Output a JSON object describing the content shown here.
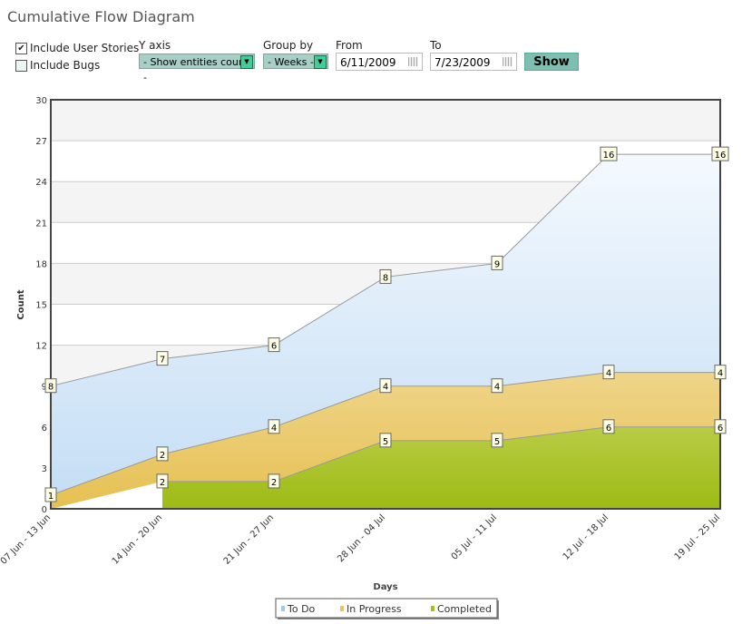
{
  "title": "Cumulative Flow Diagram",
  "controls": {
    "include_user_stories": {
      "label": "Include User Stories",
      "checked": true
    },
    "include_bugs": {
      "label": "Include Bugs",
      "checked": false
    },
    "y_axis": {
      "label": "Y axis",
      "value": "- Show entities count -"
    },
    "group_by": {
      "label": "Group by",
      "value": "- Weeks -"
    },
    "from": {
      "label": "From",
      "value": "6/11/2009"
    },
    "to": {
      "label": "To",
      "value": "7/23/2009"
    },
    "show_label": "Show"
  },
  "chart_data": {
    "type": "area",
    "stacked": true,
    "xlabel": "Days",
    "ylabel": "Count",
    "ylim": [
      0,
      30
    ],
    "yticks": [
      0,
      3,
      6,
      9,
      12,
      15,
      18,
      21,
      24,
      27,
      30
    ],
    "categories": [
      "07 Jun - 13 Jun",
      "14 Jun - 20 Jun",
      "21 Jun - 27 Jun",
      "28 Jun - 04 Jul",
      "05 Jul - 11 Jul",
      "12 Jul - 18 Jul",
      "19 Jul - 25 Jul"
    ],
    "series": [
      {
        "name": "Completed",
        "color": "#a4c11b",
        "values": [
          null,
          2,
          2,
          5,
          5,
          6,
          6
        ]
      },
      {
        "name": "In Progress",
        "color": "#e9c45e",
        "values": [
          1,
          2,
          4,
          4,
          4,
          4,
          4
        ]
      },
      {
        "name": "To Do",
        "color": "#cfe4f7",
        "values": [
          8,
          7,
          6,
          8,
          9,
          16,
          16
        ]
      }
    ],
    "legend": "bottom"
  }
}
